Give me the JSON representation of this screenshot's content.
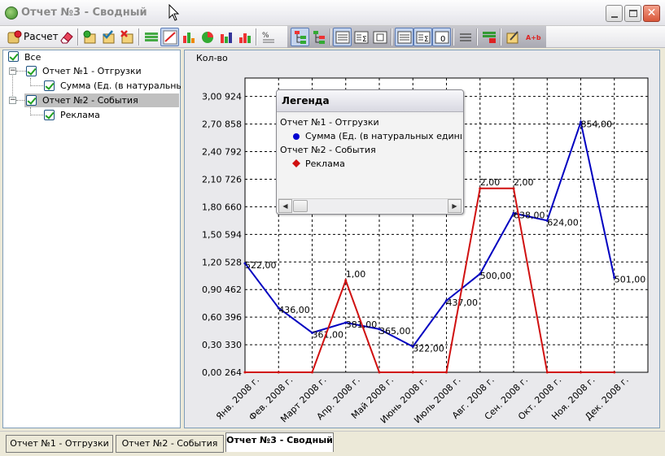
{
  "window": {
    "title": "Отчет №3 - Сводный",
    "icon": "report-icon",
    "controls": [
      "minimize-icon",
      "maximize-icon",
      "close-icon"
    ]
  },
  "toolbar": {
    "calc_label": "Расчет",
    "icons": [
      "calc-icon",
      "eraser-icon",
      "add-report-icon",
      "check-report-icon",
      "delete-report-icon",
      "table-view-icon",
      "line-chart-icon",
      "bar-chart-icon",
      "pie-chart-icon",
      "stacked-bar-icon",
      "area-chart-icon",
      "percent-icon",
      "tree-expand-icon",
      "tree-collapse-icon",
      "align-left-icon",
      "sum-icon",
      "align-center-icon",
      "align-justify-icon",
      "sum-columns-icon",
      "number-format-icon",
      "lines-icon",
      "grid-color-icon",
      "edit-icon",
      "text-format-icon"
    ]
  },
  "tree": {
    "items": [
      {
        "label": "Все",
        "checked": true
      },
      {
        "label": "Отчет №1 - Отгрузки",
        "checked": true
      },
      {
        "label": "Сумма (Ед. (в натуральных единицах)",
        "checked": true
      },
      {
        "label": "Отчет №2 - События",
        "checked": true,
        "selected": true
      },
      {
        "label": "Реклама",
        "checked": true
      }
    ]
  },
  "chart_data": {
    "type": "line",
    "title": "",
    "ylabel": "Кол-во",
    "xlabel": "",
    "categories": [
      "Янв. 2008 г.",
      "Фев. 2008 г.",
      "Март 2008 г.",
      "Апр. 2008 г.",
      "Май 2008 г.",
      "Июнь 2008 г.",
      "Июль 2008 г.",
      "Авг. 2008 г.",
      "Сен. 2008 г.",
      "Окт. 2008 г.",
      "Ноя. 2008 г.",
      "Дек. 2008 г."
    ],
    "y_ticks": [
      "0,00 264",
      "0,30 330",
      "0,60 396",
      "0,90 462",
      "1,20 528",
      "1,50 594",
      "1,80 660",
      "2,10 726",
      "2,40 792",
      "2,70 858",
      "3,00 924"
    ],
    "ylim": [
      0,
      3.2
    ],
    "grid": true,
    "legend": "top-left",
    "series": [
      {
        "name": "Сумма (Ед. (в натуральных единицах)",
        "color": "#0000c0",
        "marker": "circle",
        "values": [
          1.185,
          0.7,
          0.43,
          0.54,
          0.47,
          0.28,
          0.78,
          1.07,
          1.73,
          1.65,
          2.72,
          1.03
        ],
        "labels": [
          "522,00",
          "436,00",
          "361,00",
          "381,00",
          "365,00",
          "322,00",
          "437,00",
          "500,00",
          "638,00",
          "624,00",
          "854,00",
          "501,00"
        ]
      },
      {
        "name": "Реклама",
        "color": "#d01010",
        "marker": "diamond",
        "values": [
          0,
          0,
          0,
          1,
          0,
          0,
          0,
          2,
          2,
          0,
          0,
          0
        ],
        "labels": [
          "",
          "",
          "",
          "1,00",
          "",
          "",
          "",
          "2,00",
          "2,00",
          "",
          "",
          ""
        ]
      }
    ]
  },
  "legend": {
    "title": "Легенда",
    "groups": [
      {
        "label": "Отчет №1 - Отгрузки",
        "entry": "Сумма (Ед. (в натуральных единицах)",
        "marker_color": "#0000d0"
      },
      {
        "label": "Отчет №2 - События",
        "entry": "Реклама",
        "marker_color": "#d01010"
      }
    ]
  },
  "tabs": [
    {
      "label": "Отчет №1 - Отгрузки",
      "active": false
    },
    {
      "label": "Отчет №2 - События",
      "active": false
    },
    {
      "label": "Отчет №3 - Сводный",
      "active": true
    }
  ]
}
